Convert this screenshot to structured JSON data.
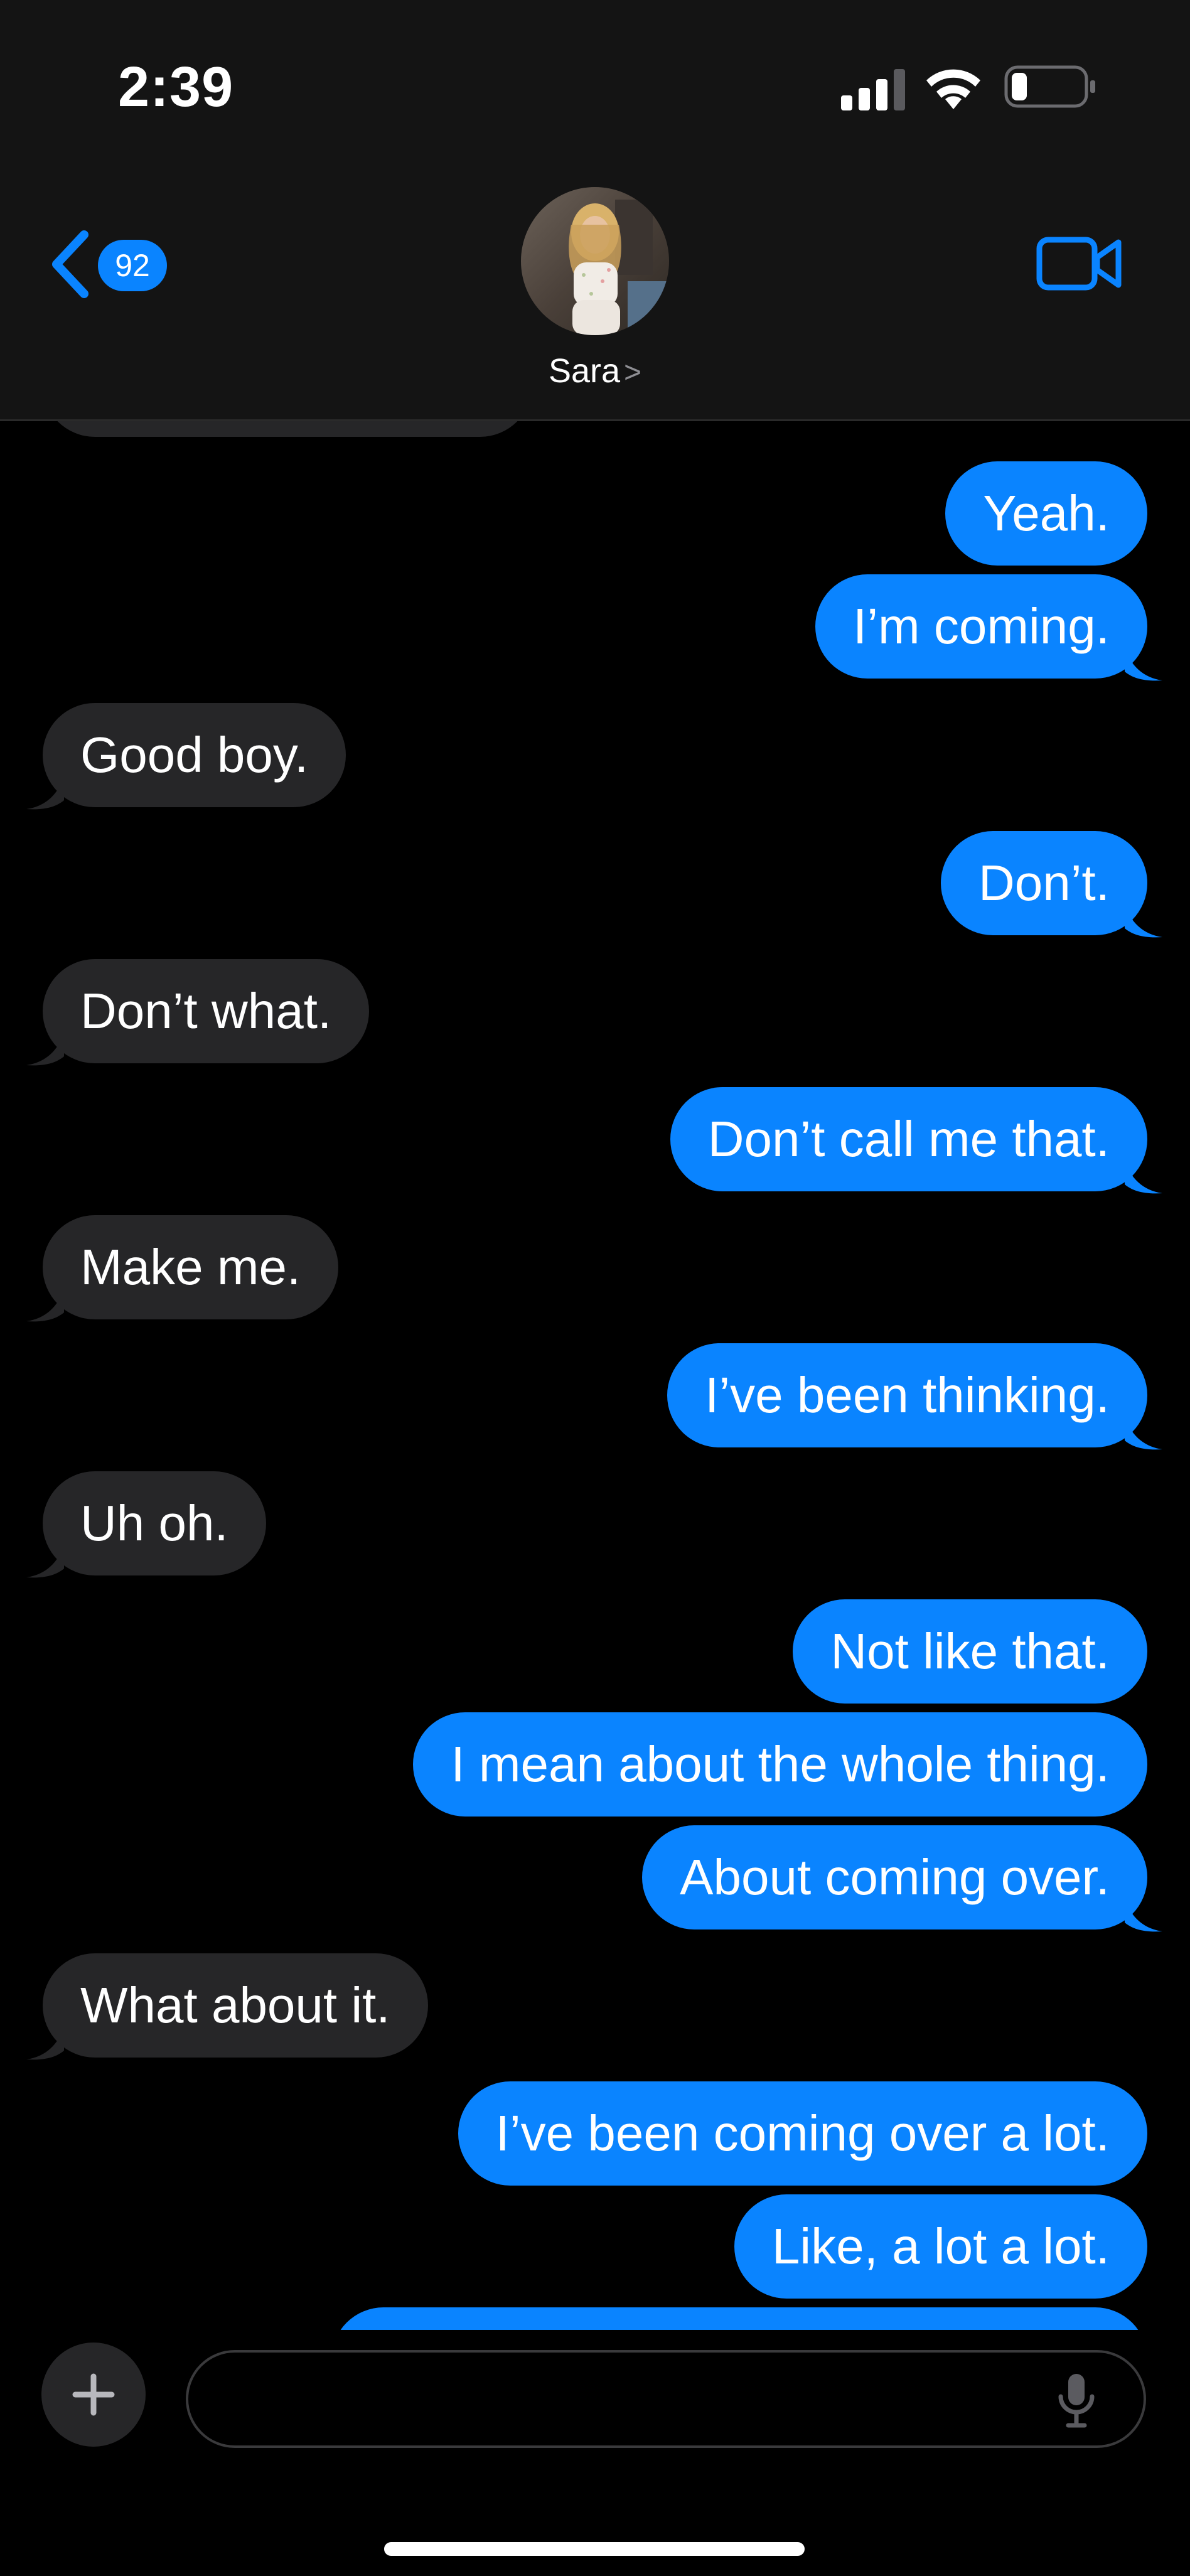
{
  "status_bar": {
    "time": "2:39"
  },
  "header": {
    "unread_count": "92",
    "contact_name": "Sara",
    "contact_chevron": ">"
  },
  "messages": [
    {
      "from": "me",
      "text": "Yeah."
    },
    {
      "from": "me",
      "text": "I’m coming."
    },
    {
      "from": "them",
      "text": "Good boy."
    },
    {
      "from": "me",
      "text": "Don’t."
    },
    {
      "from": "them",
      "text": "Don’t what."
    },
    {
      "from": "me",
      "text": "Don’t call me that."
    },
    {
      "from": "them",
      "text": "Make me."
    },
    {
      "from": "me",
      "text": "I’ve been thinking."
    },
    {
      "from": "them",
      "text": "Uh oh."
    },
    {
      "from": "me",
      "text": "Not like that."
    },
    {
      "from": "me",
      "text": "I mean about the whole thing."
    },
    {
      "from": "me",
      "text": "About coming over."
    },
    {
      "from": "them",
      "text": "What about it."
    },
    {
      "from": "me",
      "text": "I’ve been coming over a lot."
    },
    {
      "from": "me",
      "text": "Like, a lot a lot."
    }
  ],
  "composer": {
    "placeholder": ""
  },
  "colors": {
    "sent_bubble": "#0a84ff",
    "received_bubble": "#262628",
    "accent": "#0a84ff"
  }
}
